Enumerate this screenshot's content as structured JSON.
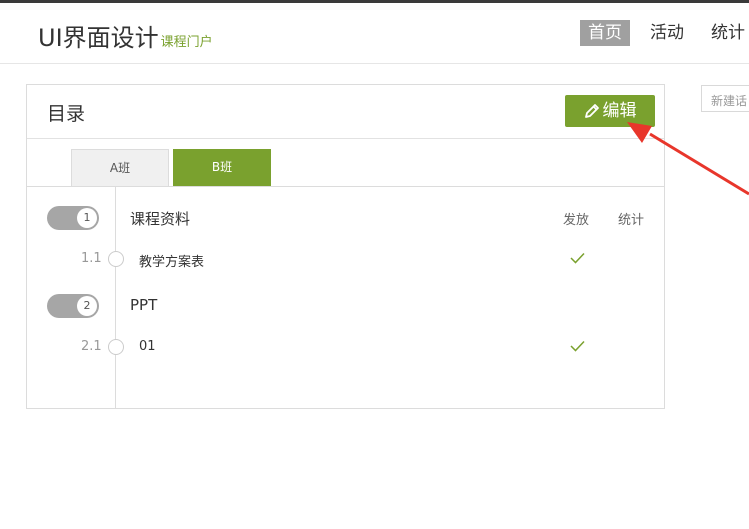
{
  "header": {
    "brand": "UI界面设计",
    "brand_sub": "课程门户",
    "nav": [
      {
        "label": "首页"
      },
      {
        "label": "活动"
      },
      {
        "label": "统计"
      }
    ]
  },
  "new_input_placeholder": "新建话",
  "panel": {
    "title": "目录",
    "edit_label": "编辑",
    "tabs": [
      {
        "label": "A班"
      },
      {
        "label": "B班"
      }
    ],
    "columns": {
      "publish": "发放",
      "stats": "统计"
    },
    "chapters": [
      {
        "num": "1",
        "title": "课程资料",
        "items": [
          {
            "num": "1.1",
            "title": "教学方案表",
            "published": true
          }
        ]
      },
      {
        "num": "2",
        "title": "PPT",
        "items": [
          {
            "num": "2.1",
            "title": "01",
            "published": true
          }
        ]
      }
    ]
  },
  "colors": {
    "accent": "#7aa12e",
    "nav_active": "#a0a0a0",
    "annotation_arrow": "#e8362b"
  }
}
